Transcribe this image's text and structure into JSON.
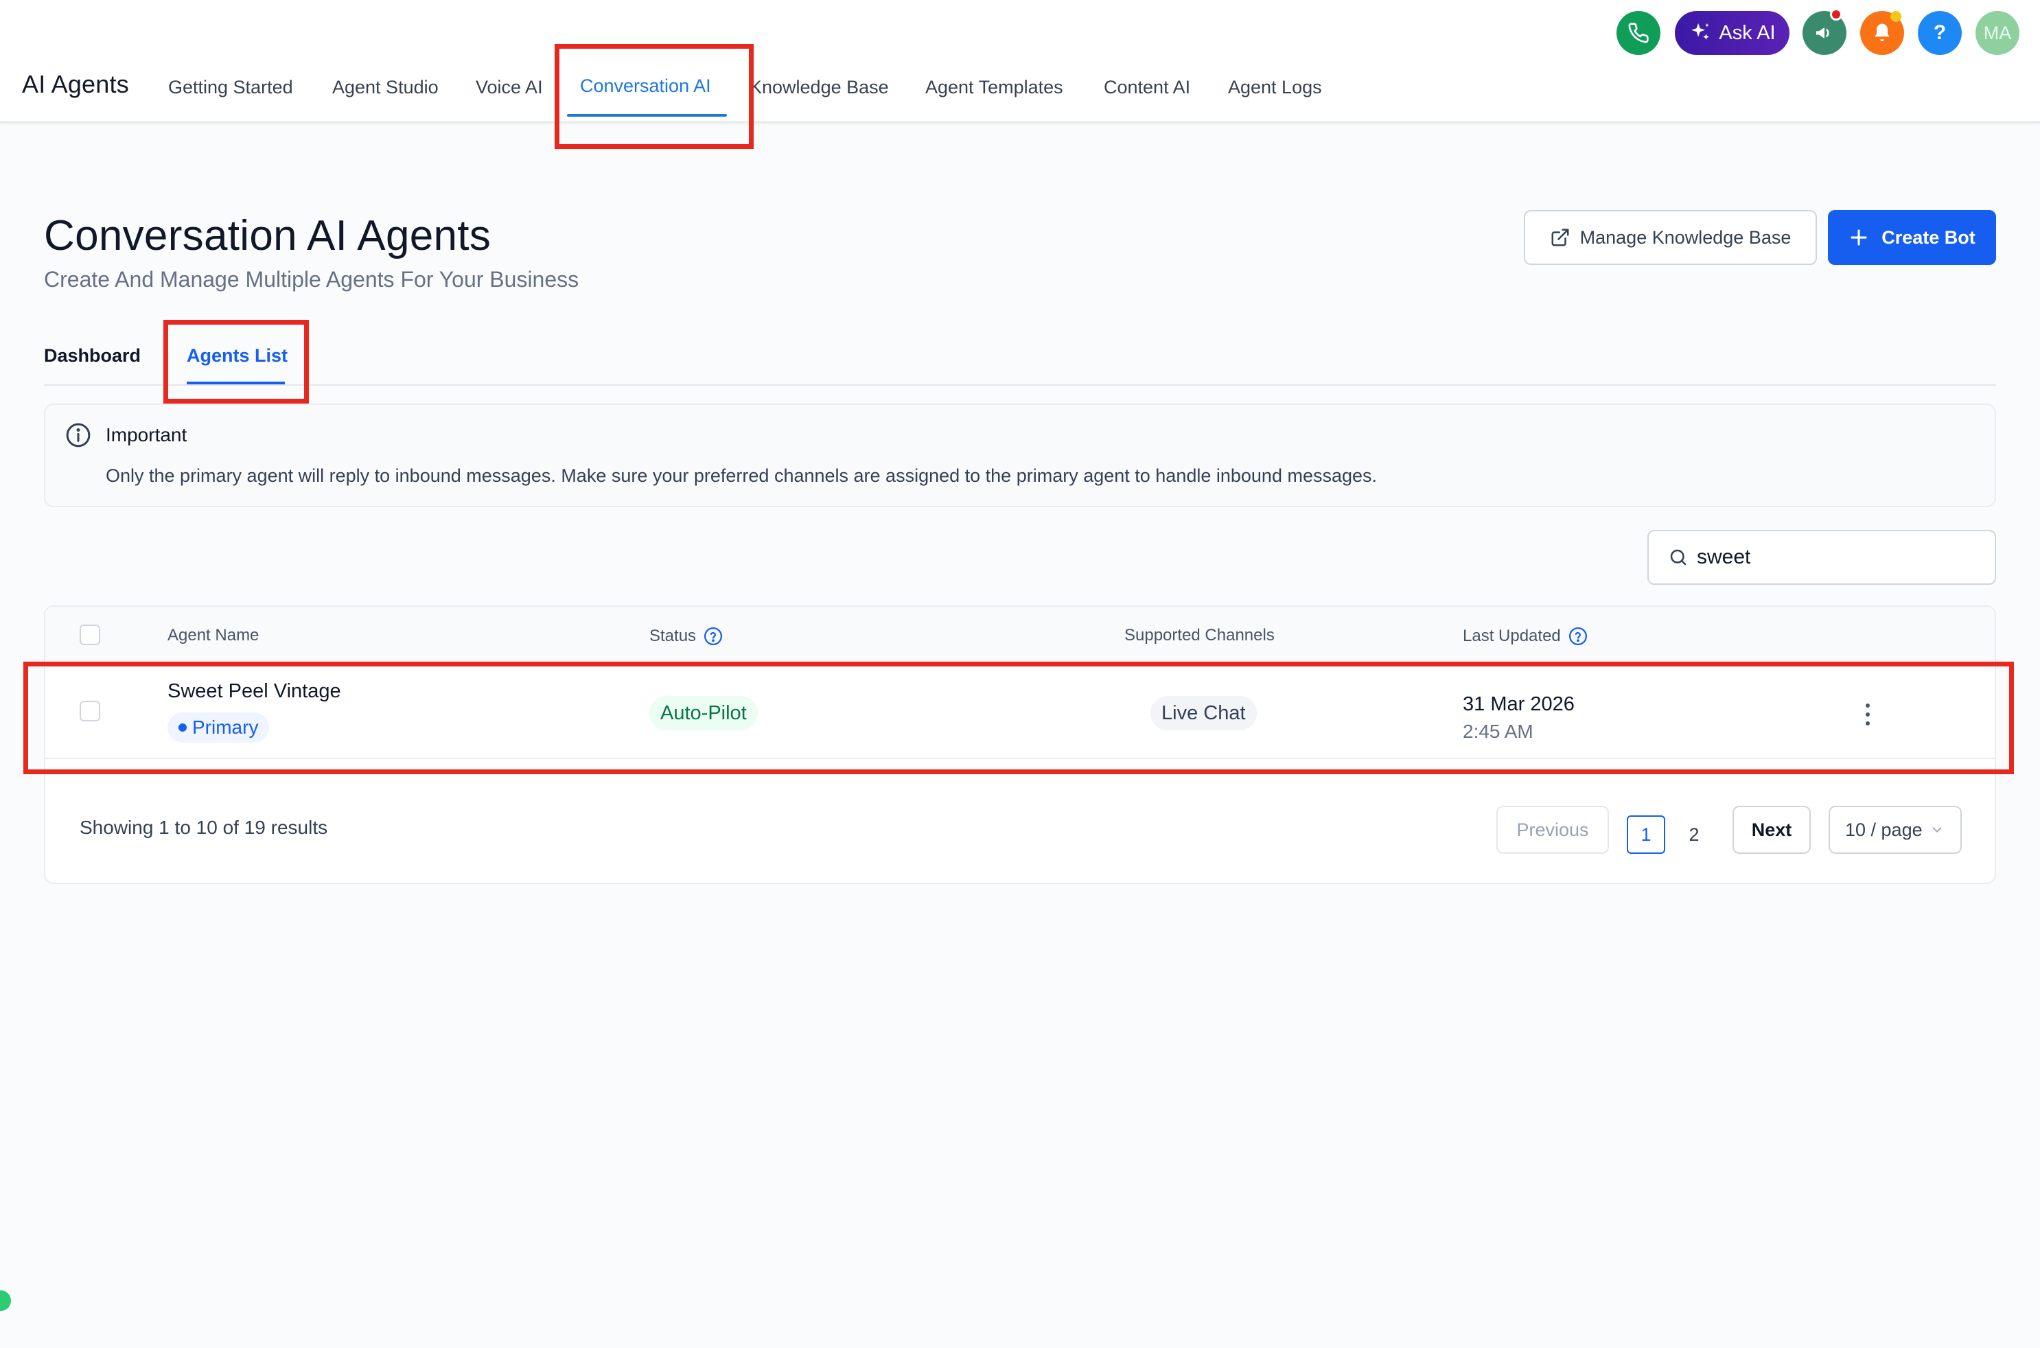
{
  "header": {
    "app_title": "AI Agents",
    "nav": [
      {
        "label": "Getting Started"
      },
      {
        "label": "Agent Studio"
      },
      {
        "label": "Voice AI"
      },
      {
        "label": "Conversation AI",
        "active": true
      },
      {
        "label": "Knowledge Base"
      },
      {
        "label": "Agent Templates"
      },
      {
        "label": "Content AI"
      },
      {
        "label": "Agent Logs"
      }
    ],
    "ask_ai_label": "Ask AI",
    "help_label": "?",
    "avatar_initials": "MA",
    "icons": [
      "phone-icon",
      "sparkle-icon",
      "megaphone-icon",
      "bell-icon",
      "help-icon"
    ]
  },
  "page": {
    "title": "Conversation AI Agents",
    "subtitle": "Create And Manage Multiple Agents For Your Business",
    "manage_kb_label": "Manage Knowledge Base",
    "create_bot_label": "Create Bot"
  },
  "tabs": [
    {
      "label": "Dashboard"
    },
    {
      "label": "Agents List",
      "active": true
    }
  ],
  "info": {
    "title": "Important",
    "text": "Only the primary agent will reply to inbound messages. Make sure your preferred channels are assigned to the primary agent to handle inbound messages."
  },
  "search": {
    "value": "sweet"
  },
  "table": {
    "columns": [
      "Agent Name",
      "Status",
      "Supported Channels",
      "Last Updated"
    ],
    "rows": [
      {
        "name": "Sweet Peel Vintage",
        "badge": "Primary",
        "status": "Auto-Pilot",
        "channel": "Live Chat",
        "date": "31 Mar 2026",
        "time": "2:45 AM"
      }
    ]
  },
  "pagination": {
    "showing": "Showing 1 to 10 of 19 results",
    "previous": "Previous",
    "pages": [
      "1",
      "2"
    ],
    "current_page": "1",
    "next": "Next",
    "page_size": "10 / page"
  },
  "colors": {
    "accent": "#155eef",
    "nav_active": "#1d77e0",
    "highlight": "#e8281e",
    "status_green": "#067647"
  }
}
